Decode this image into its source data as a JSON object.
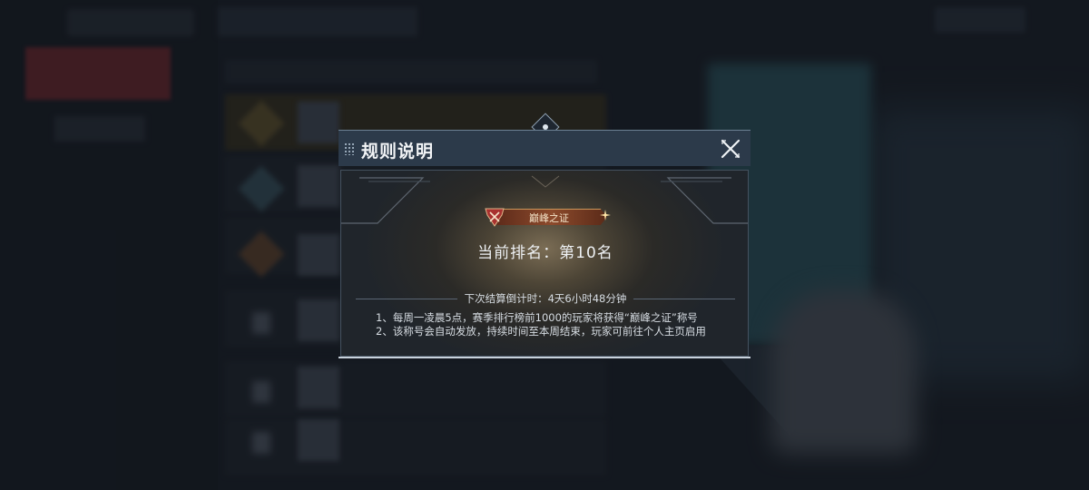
{
  "modal": {
    "title": "规则说明",
    "badge_label": "巅峰之证",
    "rank_label": "当前排名：第10名",
    "countdown": "下次结算倒计时：4天6小时48分钟",
    "rules": [
      "1、每周一凌晨5点，赛季排行榜前1000的玩家将获得“巅峰之证”称号",
      "2、该称号会自动发放，持续时间至本周结束，玩家可前往个人主页启用"
    ]
  },
  "icons": {
    "close": "close-icon",
    "badge_emblem": "crest-icon",
    "top_gem": "diamond-ornament-icon"
  },
  "colors": {
    "header_bg": "#2c3a4a",
    "badge_plate": "#8c4a2c",
    "background": "#1c222b"
  }
}
